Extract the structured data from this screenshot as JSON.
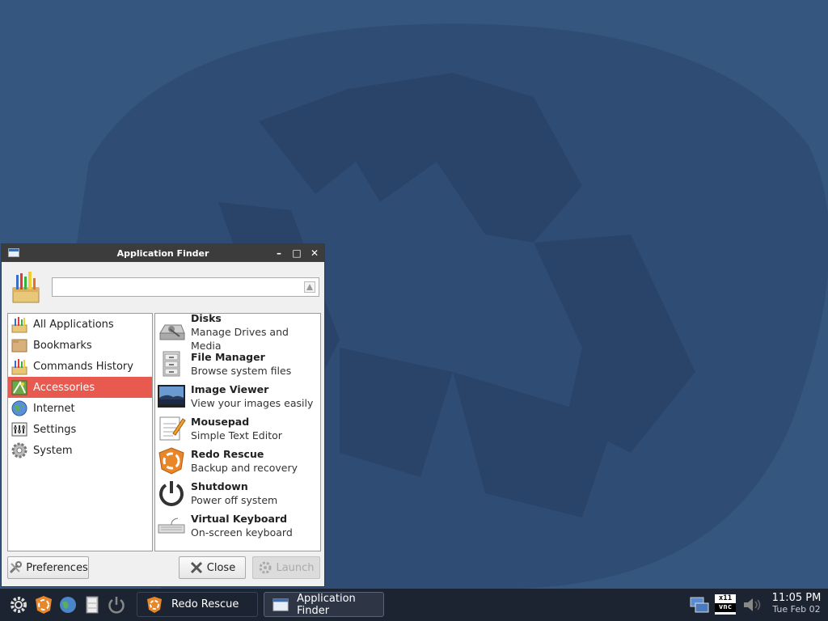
{
  "colors": {
    "desktop": "#34567f",
    "selection": "#e85a4f",
    "taskbar": "#1c2331"
  },
  "window": {
    "title": "Application Finder",
    "controls": {
      "minimize": "–",
      "maximize": "□",
      "close": "✕"
    },
    "search": {
      "value": "",
      "placeholder": ""
    },
    "categories": [
      {
        "label": "All Applications",
        "icon": "all-apps-icon"
      },
      {
        "label": "Bookmarks",
        "icon": "bookmarks-icon"
      },
      {
        "label": "Commands History",
        "icon": "history-icon"
      },
      {
        "label": "Accessories",
        "icon": "accessories-icon",
        "selected": true
      },
      {
        "label": "Internet",
        "icon": "globe-icon"
      },
      {
        "label": "Settings",
        "icon": "settings-icon"
      },
      {
        "label": "System",
        "icon": "system-gear-icon"
      }
    ],
    "apps": [
      {
        "name": "Disks",
        "desc": "Manage Drives and Media",
        "icon": "disks-icon"
      },
      {
        "name": "File Manager",
        "desc": "Browse system files",
        "icon": "file-cabinet-icon"
      },
      {
        "name": "Image Viewer",
        "desc": "View your images easily",
        "icon": "image-viewer-icon"
      },
      {
        "name": "Mousepad",
        "desc": "Simple Text Editor",
        "icon": "notepad-icon"
      },
      {
        "name": "Redo Rescue",
        "desc": "Backup and recovery",
        "icon": "redo-rescue-icon"
      },
      {
        "name": "Shutdown",
        "desc": "Power off system",
        "icon": "power-icon"
      },
      {
        "name": "Virtual Keyboard",
        "desc": "On-screen keyboard",
        "icon": "keyboard-icon"
      }
    ],
    "buttons": {
      "preferences": "Preferences",
      "close": "Close",
      "launch": "Launch"
    }
  },
  "taskbar": {
    "tasks": [
      {
        "label": "Redo Rescue",
        "icon": "redo-rescue-icon"
      },
      {
        "label": "Application Finder",
        "icon": "window-icon",
        "active": true
      }
    ],
    "tray": {
      "vnc_label_top": "x11",
      "vnc_label_bottom": "vnc"
    },
    "clock": {
      "time": "11:05 PM",
      "date": "Tue Feb 02"
    }
  }
}
